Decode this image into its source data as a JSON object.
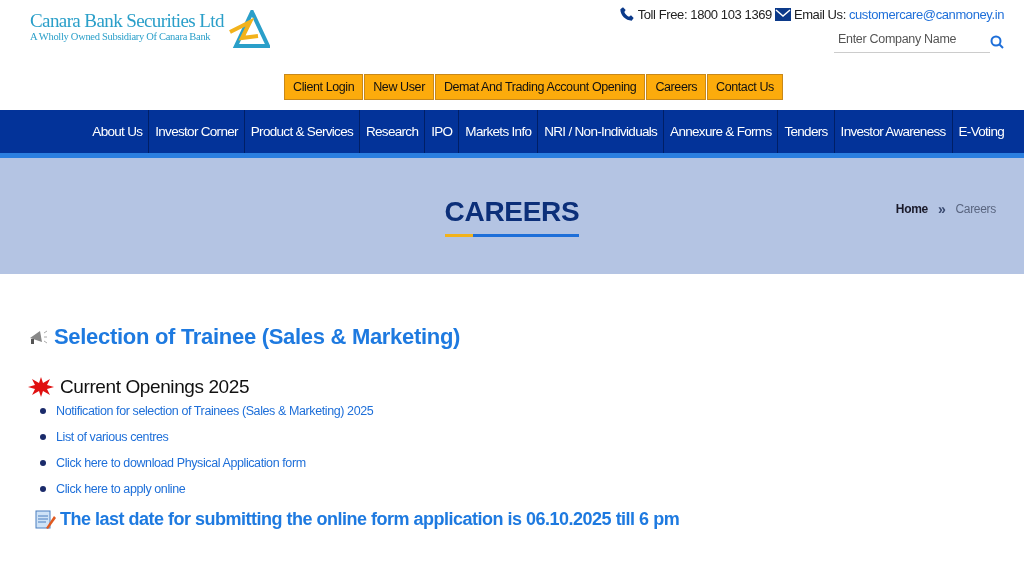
{
  "logo": {
    "name": "Canara Bank Securities Ltd",
    "tagline": "A Wholly Owned Subsidiary Of Canara Bank"
  },
  "contact": {
    "toll_free": "Toll Free: 1800 103 1369",
    "email_label": "Email Us:",
    "email": "customercare@canmoney.in"
  },
  "search": {
    "placeholder": "Enter Company Name"
  },
  "top_buttons": [
    "Client Login",
    "New User",
    "Demat And Trading Account Opening",
    "Careers",
    "Contact Us"
  ],
  "nav": [
    "About Us",
    "Investor Corner",
    "Product & Services",
    "Research",
    "IPO",
    "Markets Info",
    "NRI / Non-Individuals",
    "Annexure & Forms",
    "Tenders",
    "Investor Awareness",
    "E-Voting"
  ],
  "banner": {
    "title": "CAREERS",
    "breadcrumb": [
      {
        "label": "Home",
        "selected": false
      },
      {
        "label": "»",
        "kind": "separator"
      },
      {
        "label": "Careers",
        "selected": true
      }
    ]
  },
  "content": {
    "heading": "Selection of Trainee (Sales & Marketing)",
    "subheading": "Current Openings 2025",
    "links": [
      "Notification for selection of Trainees (Sales & Marketing) 2025",
      "List of various centres",
      "Click here to download Physical Application form",
      "Click here to apply online"
    ],
    "notice": "The last date for submitting the online form application is 06.10.2025 till 6 pm"
  }
}
